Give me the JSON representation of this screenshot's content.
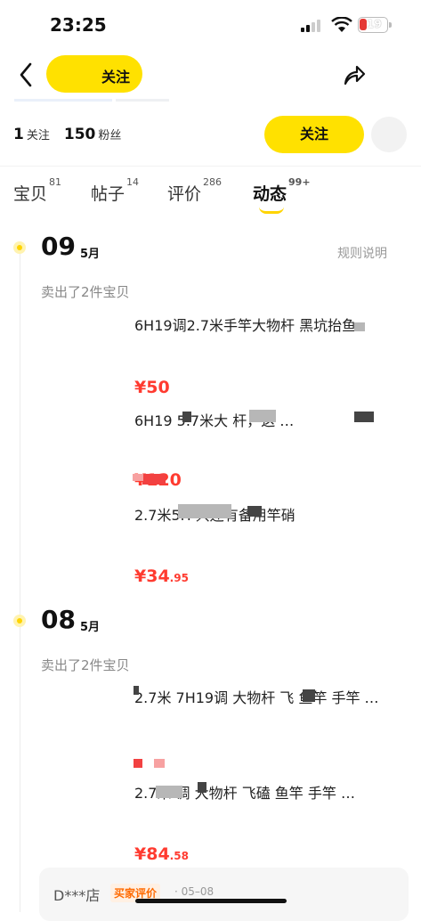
{
  "status_bar": {
    "time": "23:25",
    "battery": "19"
  },
  "header": {
    "follow_label": "关注"
  },
  "stats": {
    "following_num": "1",
    "following_label": "关注",
    "fans_num": "150",
    "fans_label": "粉丝",
    "follow_button": "关注"
  },
  "tabs": [
    {
      "label": "宝贝",
      "count": "81"
    },
    {
      "label": "帖子",
      "count": "14"
    },
    {
      "label": "评价",
      "count": "286"
    },
    {
      "label": "动态",
      "count": "99+"
    }
  ],
  "rules_label": "规则说明",
  "groups": [
    {
      "day": "09",
      "month": "5月",
      "sold_text": "卖出了2件宝贝",
      "items": [
        {
          "title": "6H19调2.7米手竿大物杆 黑坑抬鱼",
          "price_int": "¥50",
          "price_dec": ""
        },
        {
          "title": "6H19 5.7米大 杆，这 …",
          "price_int": "¥120",
          "price_dec": ""
        },
        {
          "title": "2.7米5H   只还有备用竿硝",
          "price_int": "¥34",
          "price_dec": ".95"
        }
      ]
    },
    {
      "day": "08",
      "month": "5月",
      "sold_text": "卖出了2件宝贝",
      "items": [
        {
          "title": "2.7米 7H19调 大物杆 飞  鱼竿 手竿 …",
          "price_int": "",
          "price_dec": ""
        },
        {
          "title": "2.7米    调 大物杆 飞磕 鱼竿 手竿 …",
          "price_int": "¥84",
          "price_dec": ".58"
        }
      ]
    }
  ],
  "review": {
    "name": "D***店",
    "tag": "买家评价",
    "date": "· 05–08"
  },
  "colors": {
    "accent": "#ffe100",
    "price": "#ff3b30"
  }
}
